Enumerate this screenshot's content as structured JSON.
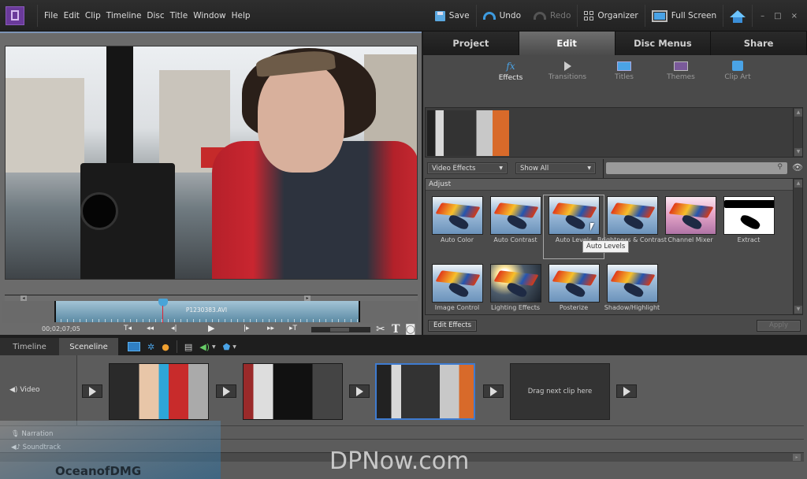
{
  "app": {
    "menu": [
      "File",
      "Edit",
      "Clip",
      "Timeline",
      "Disc",
      "Title",
      "Window",
      "Help"
    ],
    "toolbar": {
      "save": "Save",
      "undo": "Undo",
      "redo": "Redo",
      "organizer": "Organizer",
      "fullscreen": "Full Screen"
    },
    "window_controls": {
      "minimize": "–",
      "maximize": "□",
      "close": "×"
    }
  },
  "preview": {
    "clip_name": "P1230383.AVI",
    "timecode": "00;02;07;05",
    "transport": {
      "goto_in": "T◂",
      "rewind": "◂◂",
      "step_back": "◂|",
      "play": "▶",
      "step_fwd": "|▸",
      "fast_fwd": "▸▸",
      "goto_out": "▸T"
    },
    "tools": {
      "split": "✂",
      "title": "T",
      "snapshot": "◙"
    }
  },
  "right_panel": {
    "tabs": [
      {
        "label": "Project",
        "active": false
      },
      {
        "label": "Edit",
        "active": true
      },
      {
        "label": "Disc Menus",
        "active": false
      },
      {
        "label": "Share",
        "active": false
      }
    ],
    "subtabs": [
      {
        "label": "Effects",
        "icon": "fx-icon",
        "active": true
      },
      {
        "label": "Transitions",
        "icon": "transitions-icon",
        "active": false
      },
      {
        "label": "Titles",
        "icon": "titles-icon",
        "active": false
      },
      {
        "label": "Themes",
        "icon": "themes-icon",
        "active": false
      },
      {
        "label": "Clip Art",
        "icon": "clip-art-icon",
        "active": false
      }
    ],
    "filter": {
      "category": "Video Effects",
      "show": "Show All",
      "search_value": ""
    },
    "gallery_heading": "Adjust",
    "effects": [
      {
        "label": "Auto Color",
        "style": ""
      },
      {
        "label": "Auto Contrast",
        "style": ""
      },
      {
        "label": "Auto Levels",
        "style": "",
        "selected": true
      },
      {
        "label": "Brightness & Contrast",
        "style": ""
      },
      {
        "label": "Channel Mixer",
        "style": "pink"
      },
      {
        "label": "Extract",
        "style": "extract"
      },
      {
        "label": "Image Control",
        "style": ""
      },
      {
        "label": "Lighting Effects",
        "style": "light"
      },
      {
        "label": "Posterize",
        "style": ""
      },
      {
        "label": "Shadow/Highlight",
        "style": ""
      }
    ],
    "tooltip": "Auto Levels",
    "buttons": {
      "edit_effects": "Edit Effects",
      "apply": "Apply"
    }
  },
  "sceneline": {
    "tabs": [
      {
        "label": "Timeline",
        "active": false
      },
      {
        "label": "Sceneline",
        "active": true
      }
    ],
    "tracks": {
      "video": "Video",
      "narration": "Narration",
      "soundtrack": "Soundtrack"
    },
    "dropzone": "Drag next clip here"
  },
  "watermarks": {
    "dpnow": "DPNow.com",
    "ocean": "OceanofDMG"
  },
  "colors": {
    "accent": "#4aa3e6",
    "selection": "#3e7bd0",
    "logo": "#6a3a9a"
  }
}
